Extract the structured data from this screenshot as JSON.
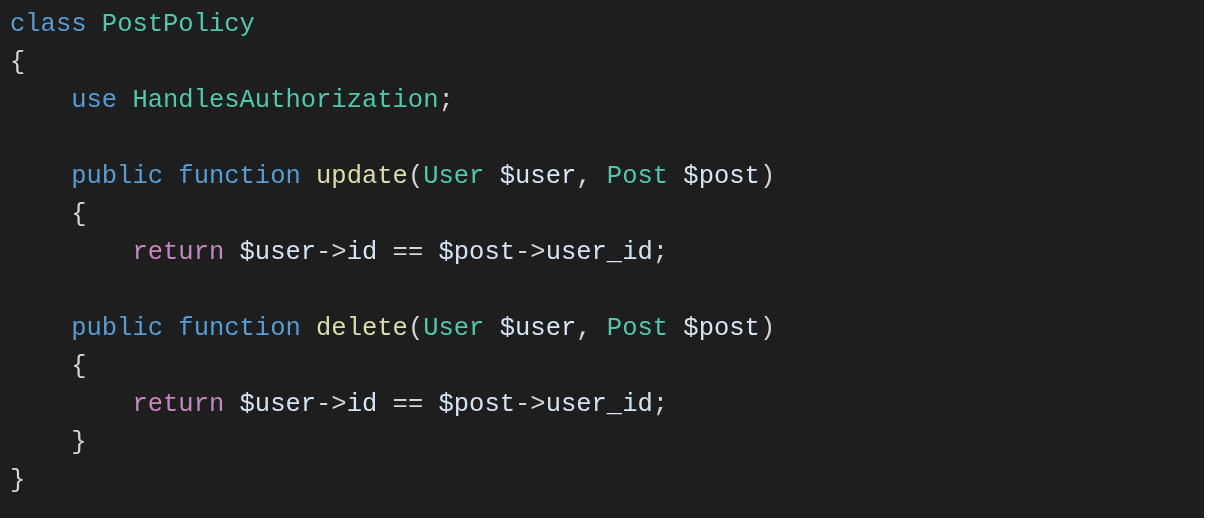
{
  "code_lines": [
    {
      "kind": "code",
      "tokens": [
        {
          "text": "class ",
          "kind": "keyword"
        },
        {
          "text": "PostPolicy",
          "kind": "type"
        }
      ]
    },
    {
      "kind": "code",
      "tokens": [
        {
          "text": "{",
          "kind": "punct"
        }
      ]
    },
    {
      "kind": "code",
      "tokens": [
        {
          "text": "    use ",
          "kind": "keyword"
        },
        {
          "text": "HandlesAuthorization",
          "kind": "type"
        },
        {
          "text": ";",
          "kind": "punct"
        }
      ]
    },
    {
      "kind": "blank"
    },
    {
      "kind": "code",
      "tokens": [
        {
          "text": "    public function ",
          "kind": "keyword"
        },
        {
          "text": "update",
          "kind": "function"
        },
        {
          "text": "(",
          "kind": "punct"
        },
        {
          "text": "User ",
          "kind": "type"
        },
        {
          "text": "$user",
          "kind": "variable"
        },
        {
          "text": ", ",
          "kind": "punct"
        },
        {
          "text": "Post ",
          "kind": "type"
        },
        {
          "text": "$post",
          "kind": "variable"
        },
        {
          "text": ")",
          "kind": "punct"
        }
      ]
    },
    {
      "kind": "code",
      "tokens": [
        {
          "text": "    {",
          "kind": "punct"
        }
      ]
    },
    {
      "kind": "code",
      "tokens": [
        {
          "text": "        return ",
          "kind": "control"
        },
        {
          "text": "$user",
          "kind": "variable"
        },
        {
          "text": "->",
          "kind": "punct"
        },
        {
          "text": "id",
          "kind": "variable"
        },
        {
          "text": " == ",
          "kind": "punct"
        },
        {
          "text": "$post",
          "kind": "variable"
        },
        {
          "text": "->",
          "kind": "punct"
        },
        {
          "text": "user_id",
          "kind": "variable"
        },
        {
          "text": ";",
          "kind": "punct"
        }
      ]
    },
    {
      "kind": "blank"
    },
    {
      "kind": "code",
      "tokens": [
        {
          "text": "    public function ",
          "kind": "keyword"
        },
        {
          "text": "delete",
          "kind": "function"
        },
        {
          "text": "(",
          "kind": "punct"
        },
        {
          "text": "User ",
          "kind": "type"
        },
        {
          "text": "$user",
          "kind": "variable"
        },
        {
          "text": ", ",
          "kind": "punct"
        },
        {
          "text": "Post ",
          "kind": "type"
        },
        {
          "text": "$post",
          "kind": "variable"
        },
        {
          "text": ")",
          "kind": "punct"
        }
      ]
    },
    {
      "kind": "code",
      "tokens": [
        {
          "text": "    {",
          "kind": "punct"
        }
      ]
    },
    {
      "kind": "code",
      "tokens": [
        {
          "text": "        return ",
          "kind": "control"
        },
        {
          "text": "$user",
          "kind": "variable"
        },
        {
          "text": "->",
          "kind": "punct"
        },
        {
          "text": "id",
          "kind": "variable"
        },
        {
          "text": " == ",
          "kind": "punct"
        },
        {
          "text": "$post",
          "kind": "variable"
        },
        {
          "text": "->",
          "kind": "punct"
        },
        {
          "text": "user_id",
          "kind": "variable"
        },
        {
          "text": ";",
          "kind": "punct"
        }
      ]
    },
    {
      "kind": "code",
      "tokens": [
        {
          "text": "    }",
          "kind": "punct"
        }
      ]
    },
    {
      "kind": "code",
      "tokens": [
        {
          "text": "}",
          "kind": "punct"
        }
      ]
    }
  ]
}
